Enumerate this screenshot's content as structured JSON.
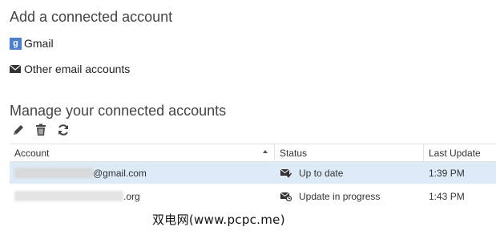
{
  "add_section": {
    "title": "Add a connected account",
    "providers": [
      {
        "icon": "gmail-icon",
        "label": "Gmail"
      },
      {
        "icon": "envelope-icon",
        "label": "Other email accounts"
      }
    ]
  },
  "manage_section": {
    "title": "Manage your connected accounts",
    "toolbar": [
      "edit-icon",
      "delete-icon",
      "refresh-icon"
    ]
  },
  "accounts_table": {
    "columns": [
      "Account",
      "Status",
      "Last Update"
    ],
    "sort_column": "Account",
    "rows": [
      {
        "account_suffix": "@gmail.com",
        "status": "Up to date",
        "last_update": "1:39 PM",
        "selected": true
      },
      {
        "account_suffix": ".org",
        "status": "Update in progress",
        "last_update": "1:43 PM",
        "selected": false
      }
    ]
  },
  "colors": {
    "selected_row": "#ddeaf7",
    "gmail_icon": "#4a7fd8"
  },
  "watermark": "双电网(www.pcpc.me)"
}
